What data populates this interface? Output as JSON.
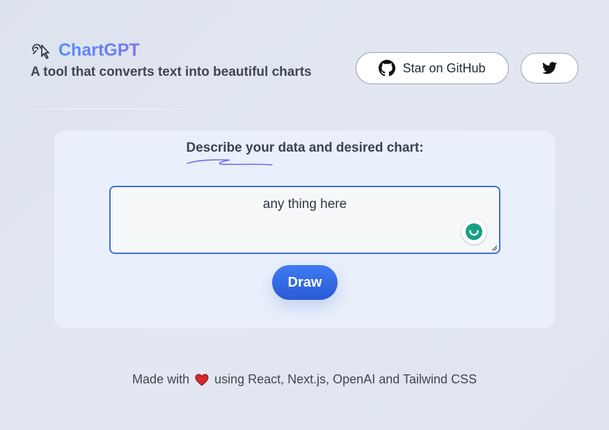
{
  "header": {
    "brand": "ChartGPT",
    "tagline": "A tool that converts text into beautiful charts",
    "github_label": "Star on GitHub",
    "logo_icon": "chart-hand-icon",
    "github_icon": "github-icon",
    "twitter_icon": "twitter-icon"
  },
  "main": {
    "prompt_label": "Describe your data and desired chart:",
    "input_value": "any thing here",
    "draw_label": "Draw"
  },
  "footer": {
    "prefix": "Made with",
    "heart_icon": "heart-icon",
    "suffix": "using React, Next.js, OpenAI and Tailwind CSS"
  },
  "colors": {
    "accent": "#3b6fd9",
    "brand_gradient_start": "#4f8ff7",
    "brand_gradient_end": "#7b74f0",
    "heart": "#d62828",
    "grammarly": "#15a085"
  }
}
